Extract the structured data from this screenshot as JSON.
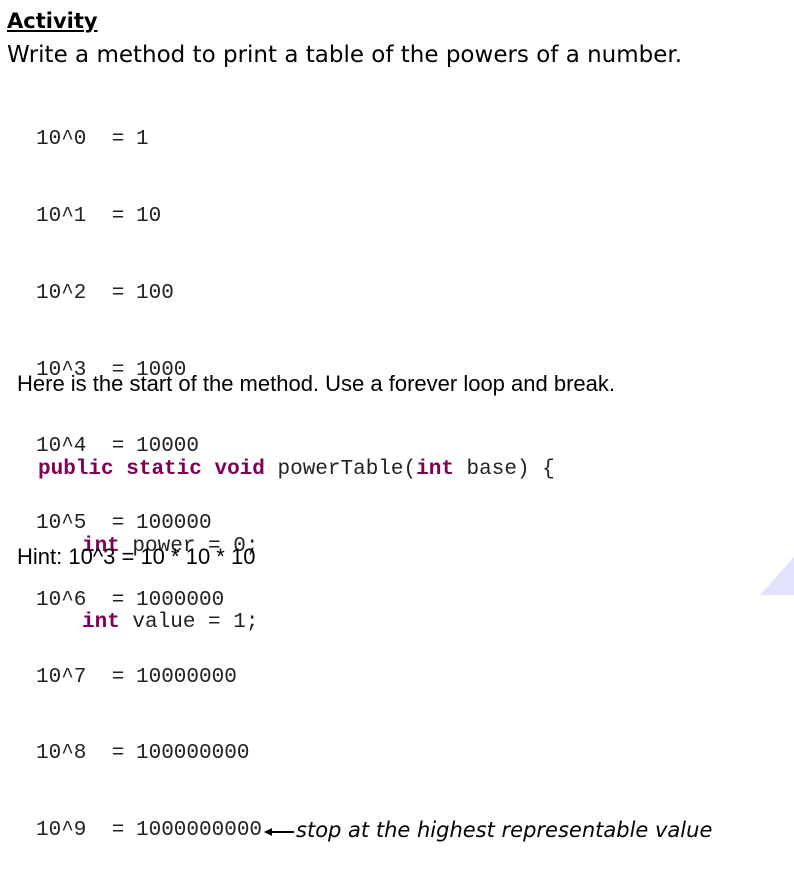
{
  "slide": {
    "title": "Activity",
    "subtitle": "Write a method to print a table of the powers of a number.",
    "powers_table": [
      {
        "expr": "10^0",
        "eq": "=",
        "value": "1"
      },
      {
        "expr": "10^1",
        "eq": "=",
        "value": "10"
      },
      {
        "expr": "10^2",
        "eq": "=",
        "value": "100"
      },
      {
        "expr": "10^3",
        "eq": "=",
        "value": "1000"
      },
      {
        "expr": "10^4",
        "eq": "=",
        "value": "10000"
      },
      {
        "expr": "10^5",
        "eq": "=",
        "value": "100000"
      },
      {
        "expr": "10^6",
        "eq": "=",
        "value": "1000000"
      },
      {
        "expr": "10^7",
        "eq": "=",
        "value": "10000000"
      },
      {
        "expr": "10^8",
        "eq": "=",
        "value": "100000000"
      },
      {
        "expr": "10^9",
        "eq": "=",
        "value": "1000000000"
      }
    ],
    "annotation": "stop at the highest representable value",
    "instruction": "Here is the start of the method.  Use a forever loop and break.",
    "code": {
      "line1": {
        "kw1": "public",
        "kw2": "static",
        "kw3": "void",
        "name": "powerTable(",
        "kw4": "int",
        "rest": "base) {"
      },
      "line2": {
        "kw": "int",
        "rest": "power = 0;"
      },
      "line3": {
        "kw": "int",
        "rest": "value = 1;"
      }
    },
    "hint": "Hint: 10^3 = 10 * 10 * 10"
  },
  "colors": {
    "keyword": "#7f0055",
    "corner_accent": "#e2e2fa"
  }
}
